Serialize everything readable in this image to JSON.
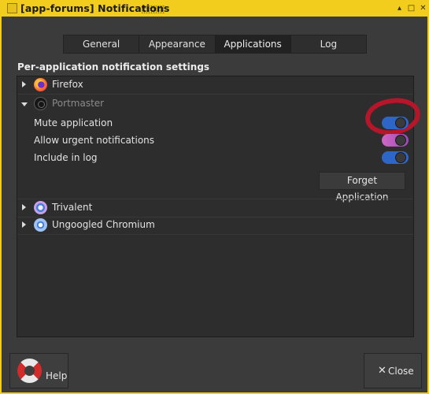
{
  "window": {
    "title": "[app-forums] Notifications",
    "titlebar_color": "#f2cd1e"
  },
  "tabs": [
    {
      "label": "General",
      "active": false
    },
    {
      "label": "Appearance",
      "active": false
    },
    {
      "label": "Applications",
      "active": true
    },
    {
      "label": "Log",
      "active": false
    }
  ],
  "section": {
    "heading": "Per-application notification settings"
  },
  "apps": [
    {
      "name": "Firefox",
      "expanded": false,
      "icon": "firefox-icon"
    },
    {
      "name": "Portmaster",
      "expanded": true,
      "icon": "portmaster-icon",
      "settings": [
        {
          "label": "Mute application",
          "enabled": true
        },
        {
          "label": "Allow urgent notifications",
          "enabled": true
        },
        {
          "label": "Include in log",
          "enabled": true
        }
      ],
      "forget_label": "Forget Application"
    },
    {
      "name": "Trivalent",
      "expanded": false,
      "icon": "trivalent-icon"
    },
    {
      "name": "Ungoogled Chromium",
      "expanded": false,
      "icon": "chromium-icon"
    }
  ],
  "footer": {
    "help_label": "Help",
    "close_label": "Close"
  },
  "accent_color": "#2e66c8"
}
